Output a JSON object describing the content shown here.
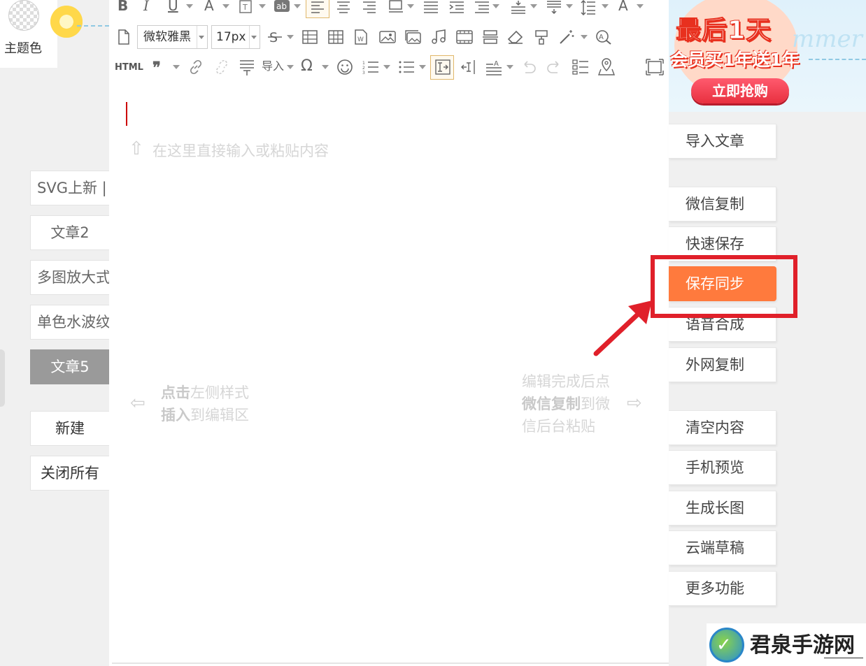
{
  "theme": {
    "label": "主题色"
  },
  "toolbar": {
    "font_family": "微软雅黑",
    "font_size": "17px",
    "html_label": "HTML",
    "import_label": "导入"
  },
  "editor": {
    "placeholder_hint": "在这里直接输入或粘贴内容",
    "left_hint_bold1": "点击",
    "left_hint_text1": "左侧样式",
    "left_hint_bold2": "插入",
    "left_hint_text2": "到编辑区",
    "right_hint_line1": "编辑完成后点",
    "right_hint_bold": "微信复制",
    "right_hint_text2": "到微",
    "right_hint_line3": "信后台粘贴"
  },
  "left_panel": {
    "articles": [
      "SVG上新 |",
      "文章2",
      "多图放大式",
      "单色水波纹",
      "文章5"
    ],
    "new_label": "新建",
    "close_all_label": "关闭所有"
  },
  "right_panel": {
    "buttons": [
      "导入文章",
      "微信复制",
      "快速保存",
      "保存同步",
      "语音合成",
      "外网复制",
      "清空内容",
      "手机预览",
      "生成长图",
      "云端草稿",
      "更多功能"
    ]
  },
  "promo": {
    "line1": "最后1天",
    "line2": "会员买1年送1年",
    "button": "立即抢购",
    "en": "mmer"
  },
  "watermark": {
    "text": "君泉手游网"
  },
  "colors": {
    "accent": "#ff7a3d",
    "highlight": "#e0202a",
    "active_tab": "#9a9a9a"
  }
}
